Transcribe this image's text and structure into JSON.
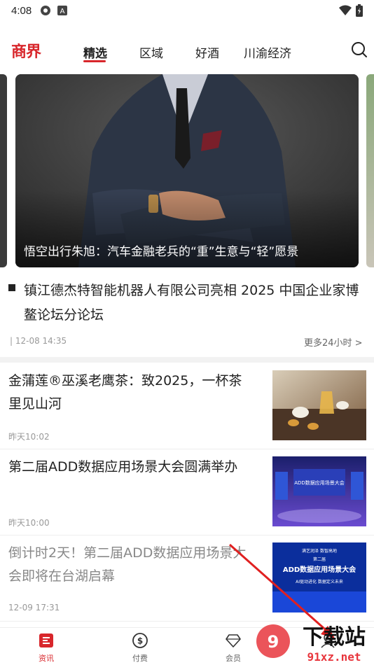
{
  "status_bar": {
    "time": "4:08"
  },
  "header": {
    "logo": "商界",
    "tabs": [
      {
        "label": "精选",
        "active": true
      },
      {
        "label": "区域",
        "active": false
      },
      {
        "label": "好酒",
        "active": false
      },
      {
        "label": "川渝经济",
        "active": false
      }
    ]
  },
  "carousel": {
    "caption": "悟空出行朱旭：汽车金融老兵的“重”生意与“轻”愿景"
  },
  "headline": {
    "title": "镇江德杰特智能机器人有限公司亮相 2025 中国企业家博鳌论坛分论坛",
    "meta": "| 12-08 14:35",
    "more_label": "更多24小时 >"
  },
  "news": [
    {
      "title": "金蒲莲®巫溪老鹰茶：致2025，一杯茶里见山河",
      "time": "昨天10:02",
      "read": false
    },
    {
      "title": "第二届ADD数据应用场景大会圆满举办",
      "time": "昨天10:00",
      "read": false
    },
    {
      "title": "倒计时2天！第二届ADD数据应用场景大会即将在台湖启幕",
      "time": "12-09 17:31",
      "read": true
    }
  ],
  "thumb_text": {
    "t2": "ADD数据应用场景大会",
    "t3_top": "满艺润泽 数智高地",
    "t3_sub": "第二届",
    "t3_main": "ADD数据应用场景大会",
    "t3_slogan": "AI驱动进化 数据定义未来"
  },
  "bottom_nav": [
    {
      "label": "资讯",
      "icon": "news-icon",
      "active": true
    },
    {
      "label": "付费",
      "icon": "dollar-icon",
      "active": false
    },
    {
      "label": "会员",
      "icon": "diamond-icon",
      "active": false
    }
  ],
  "watermark": {
    "brand": "下载站",
    "url": "91xz.net"
  },
  "colors": {
    "accent": "#d8262b",
    "muted_text": "#999999",
    "divider": "#f2f2f2"
  }
}
